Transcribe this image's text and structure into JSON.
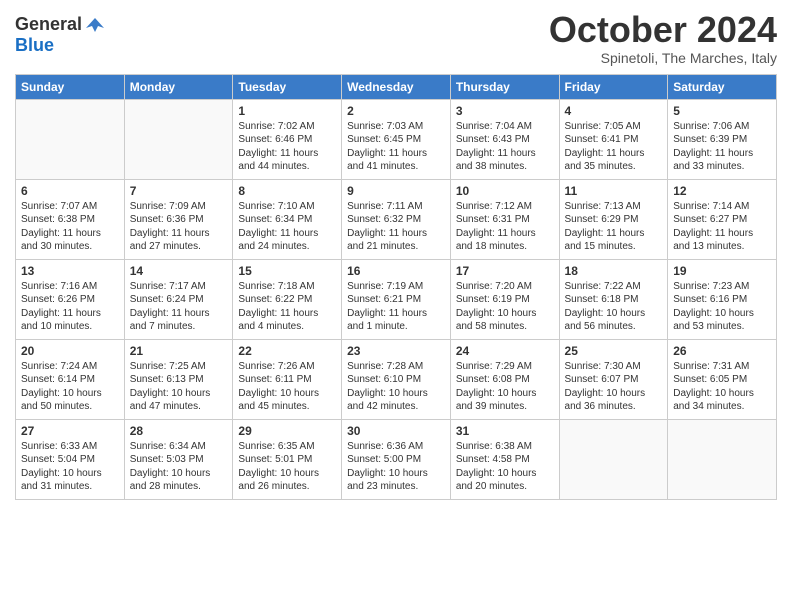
{
  "header": {
    "logo_line1": "General",
    "logo_line2": "Blue",
    "month": "October 2024",
    "location": "Spinetoli, The Marches, Italy"
  },
  "weekdays": [
    "Sunday",
    "Monday",
    "Tuesday",
    "Wednesday",
    "Thursday",
    "Friday",
    "Saturday"
  ],
  "weeks": [
    [
      {
        "day": "",
        "info": ""
      },
      {
        "day": "",
        "info": ""
      },
      {
        "day": "1",
        "info": "Sunrise: 7:02 AM\nSunset: 6:46 PM\nDaylight: 11 hours and 44 minutes."
      },
      {
        "day": "2",
        "info": "Sunrise: 7:03 AM\nSunset: 6:45 PM\nDaylight: 11 hours and 41 minutes."
      },
      {
        "day": "3",
        "info": "Sunrise: 7:04 AM\nSunset: 6:43 PM\nDaylight: 11 hours and 38 minutes."
      },
      {
        "day": "4",
        "info": "Sunrise: 7:05 AM\nSunset: 6:41 PM\nDaylight: 11 hours and 35 minutes."
      },
      {
        "day": "5",
        "info": "Sunrise: 7:06 AM\nSunset: 6:39 PM\nDaylight: 11 hours and 33 minutes."
      }
    ],
    [
      {
        "day": "6",
        "info": "Sunrise: 7:07 AM\nSunset: 6:38 PM\nDaylight: 11 hours and 30 minutes."
      },
      {
        "day": "7",
        "info": "Sunrise: 7:09 AM\nSunset: 6:36 PM\nDaylight: 11 hours and 27 minutes."
      },
      {
        "day": "8",
        "info": "Sunrise: 7:10 AM\nSunset: 6:34 PM\nDaylight: 11 hours and 24 minutes."
      },
      {
        "day": "9",
        "info": "Sunrise: 7:11 AM\nSunset: 6:32 PM\nDaylight: 11 hours and 21 minutes."
      },
      {
        "day": "10",
        "info": "Sunrise: 7:12 AM\nSunset: 6:31 PM\nDaylight: 11 hours and 18 minutes."
      },
      {
        "day": "11",
        "info": "Sunrise: 7:13 AM\nSunset: 6:29 PM\nDaylight: 11 hours and 15 minutes."
      },
      {
        "day": "12",
        "info": "Sunrise: 7:14 AM\nSunset: 6:27 PM\nDaylight: 11 hours and 13 minutes."
      }
    ],
    [
      {
        "day": "13",
        "info": "Sunrise: 7:16 AM\nSunset: 6:26 PM\nDaylight: 11 hours and 10 minutes."
      },
      {
        "day": "14",
        "info": "Sunrise: 7:17 AM\nSunset: 6:24 PM\nDaylight: 11 hours and 7 minutes."
      },
      {
        "day": "15",
        "info": "Sunrise: 7:18 AM\nSunset: 6:22 PM\nDaylight: 11 hours and 4 minutes."
      },
      {
        "day": "16",
        "info": "Sunrise: 7:19 AM\nSunset: 6:21 PM\nDaylight: 11 hours and 1 minute."
      },
      {
        "day": "17",
        "info": "Sunrise: 7:20 AM\nSunset: 6:19 PM\nDaylight: 10 hours and 58 minutes."
      },
      {
        "day": "18",
        "info": "Sunrise: 7:22 AM\nSunset: 6:18 PM\nDaylight: 10 hours and 56 minutes."
      },
      {
        "day": "19",
        "info": "Sunrise: 7:23 AM\nSunset: 6:16 PM\nDaylight: 10 hours and 53 minutes."
      }
    ],
    [
      {
        "day": "20",
        "info": "Sunrise: 7:24 AM\nSunset: 6:14 PM\nDaylight: 10 hours and 50 minutes."
      },
      {
        "day": "21",
        "info": "Sunrise: 7:25 AM\nSunset: 6:13 PM\nDaylight: 10 hours and 47 minutes."
      },
      {
        "day": "22",
        "info": "Sunrise: 7:26 AM\nSunset: 6:11 PM\nDaylight: 10 hours and 45 minutes."
      },
      {
        "day": "23",
        "info": "Sunrise: 7:28 AM\nSunset: 6:10 PM\nDaylight: 10 hours and 42 minutes."
      },
      {
        "day": "24",
        "info": "Sunrise: 7:29 AM\nSunset: 6:08 PM\nDaylight: 10 hours and 39 minutes."
      },
      {
        "day": "25",
        "info": "Sunrise: 7:30 AM\nSunset: 6:07 PM\nDaylight: 10 hours and 36 minutes."
      },
      {
        "day": "26",
        "info": "Sunrise: 7:31 AM\nSunset: 6:05 PM\nDaylight: 10 hours and 34 minutes."
      }
    ],
    [
      {
        "day": "27",
        "info": "Sunrise: 6:33 AM\nSunset: 5:04 PM\nDaylight: 10 hours and 31 minutes."
      },
      {
        "day": "28",
        "info": "Sunrise: 6:34 AM\nSunset: 5:03 PM\nDaylight: 10 hours and 28 minutes."
      },
      {
        "day": "29",
        "info": "Sunrise: 6:35 AM\nSunset: 5:01 PM\nDaylight: 10 hours and 26 minutes."
      },
      {
        "day": "30",
        "info": "Sunrise: 6:36 AM\nSunset: 5:00 PM\nDaylight: 10 hours and 23 minutes."
      },
      {
        "day": "31",
        "info": "Sunrise: 6:38 AM\nSunset: 4:58 PM\nDaylight: 10 hours and 20 minutes."
      },
      {
        "day": "",
        "info": ""
      },
      {
        "day": "",
        "info": ""
      }
    ]
  ]
}
